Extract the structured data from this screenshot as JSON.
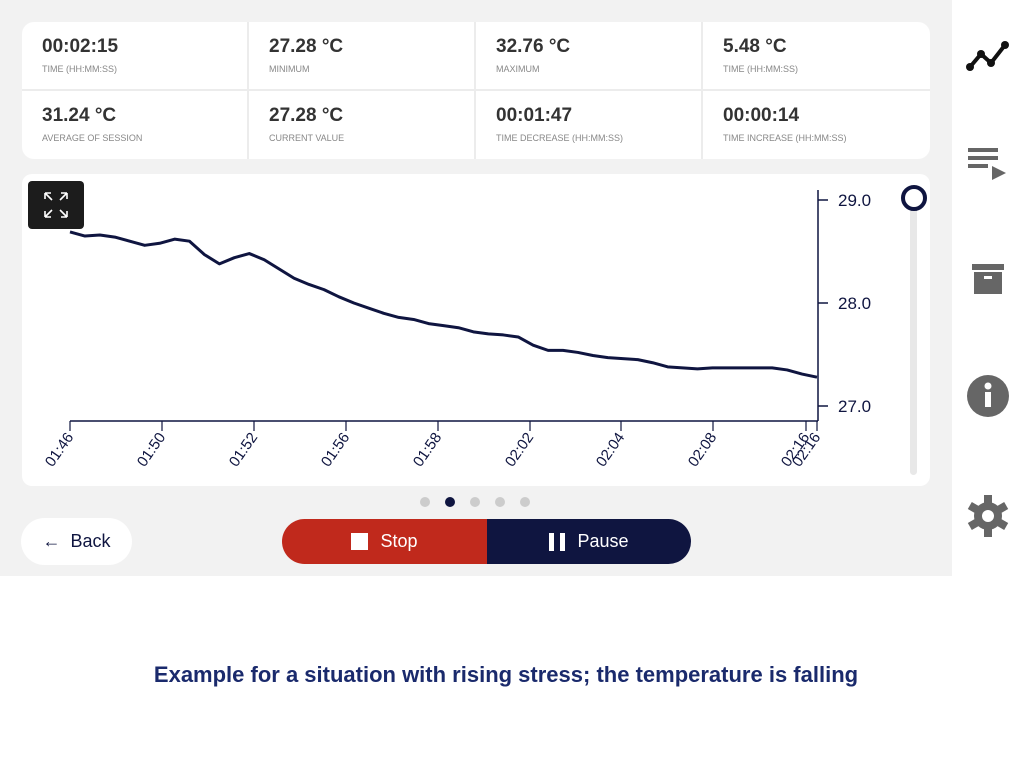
{
  "stats": [
    {
      "value": "00:02:15",
      "label": "Time (HH:MM:SS)"
    },
    {
      "value": "27.28 °C",
      "label": "Minimum"
    },
    {
      "value": "32.76 °C",
      "label": "Maximum"
    },
    {
      "value": "5.48 °C",
      "label": "Time (HH:MM:SS)"
    },
    {
      "value": "31.24 °C",
      "label": "Average of session"
    },
    {
      "value": "27.28 °C",
      "label": "Current value"
    },
    {
      "value": "00:01:47",
      "label": "Time decrease (HH:MM:SS)"
    },
    {
      "value": "00:00:14",
      "label": "Time increase (HH:MM:SS)"
    }
  ],
  "chart_data": {
    "type": "line",
    "x_tick_labels": [
      "01:46",
      "01:50",
      "01:52",
      "01:56",
      "01:58",
      "02:02",
      "02:04",
      "02:08",
      "02:16",
      "02:16"
    ],
    "y_ticks": [
      29.0,
      28.0,
      27.0
    ],
    "y_tick_labels": [
      "29.0",
      "28.0",
      "27.0"
    ],
    "ylim": [
      27.0,
      29.0
    ],
    "y_axis_side": "right",
    "line_color": "#0f1540",
    "values": [
      28.69,
      28.65,
      28.66,
      28.64,
      28.6,
      28.56,
      28.58,
      28.62,
      28.6,
      28.47,
      28.38,
      28.44,
      28.48,
      28.42,
      28.33,
      28.24,
      28.18,
      28.13,
      28.06,
      28.0,
      27.95,
      27.9,
      27.86,
      27.84,
      27.8,
      27.78,
      27.76,
      27.72,
      27.7,
      27.69,
      27.67,
      27.59,
      27.54,
      27.54,
      27.52,
      27.49,
      27.47,
      27.46,
      27.45,
      27.42,
      27.38,
      27.37,
      27.36,
      27.37,
      27.37,
      27.37,
      27.37,
      27.37,
      27.35,
      27.31,
      27.28
    ]
  },
  "pager": {
    "count": 5,
    "active": 1
  },
  "buttons": {
    "back": "Back",
    "stop": "Stop",
    "pause": "Pause"
  },
  "sidebar": [
    "chart-line-icon",
    "playlist-play-icon",
    "archive-icon",
    "info-icon",
    "gear-icon"
  ],
  "colors": {
    "stop": "#c0291c",
    "pause": "#0f1540",
    "active_icon": "#111111",
    "icon": "#666666"
  },
  "caption": "Example for a situation with rising stress; the temperature is falling"
}
